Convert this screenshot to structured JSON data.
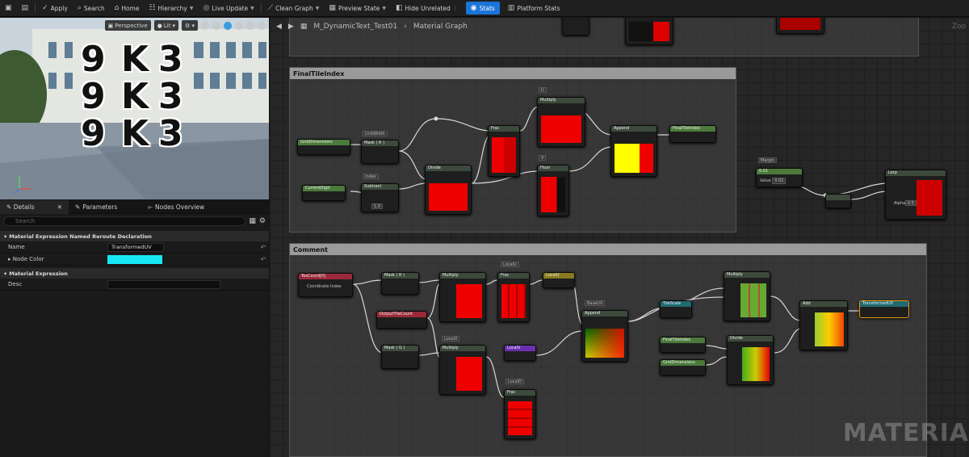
{
  "toolbar": {
    "apply": "Apply",
    "search": "Search",
    "home": "Home",
    "hierarchy": "Hierarchy",
    "live_update": "Live Update",
    "clean_graph": "Clean Graph",
    "preview_state": "Preview State",
    "hide_unrelated": "Hide Unrelated",
    "stats": "Stats",
    "platform_stats": "Platform Stats"
  },
  "viewport": {
    "perspective": "Perspective",
    "lit": "Lit",
    "digits": [
      "9",
      "K",
      "3"
    ]
  },
  "details": {
    "tabs": [
      "Details",
      "Parameters",
      "Nodes Overview"
    ],
    "search_placeholder": "Search",
    "category1": "Material Expression Named Reroute Declaration",
    "name_label": "Name",
    "name_value": "TransformedUV",
    "color_label": "Node Color",
    "color_value": "#19e6f5",
    "category2": "Material Expression",
    "desc_label": "Desc"
  },
  "graph": {
    "breadcrumb": "M_DynamicText_Test01",
    "breadcrumb2": "Material Graph",
    "zoom": "Zoo",
    "comment1": "FinalTileIndex",
    "comment2": "Comment",
    "watermark": "MATERIA",
    "nodes": {
      "grid_dimensions": "GridDimensions",
      "current_digit": "CurrentDigit",
      "mask_r": "Mask ( R )",
      "subtract": "Subtract",
      "divide": "Divide",
      "frac": "Frac",
      "multiply": "Multiply",
      "floor": "Floor",
      "append": "Append",
      "final_tile_index": "FinalTileIndex",
      "margin": "Margin",
      "margin_value": "0.01",
      "lerp": "Lerp",
      "alpha": "Alpha",
      "alpha_val": "0.5",
      "texcoord": "TexCoord[0]",
      "coord_index": "Coordinate Index",
      "output_tile_count": "OutputTileCount",
      "mask_g": "Mask ( G )",
      "local_u": "LocalU",
      "local_v": "LocalV",
      "tile_scale": "TileScale",
      "final_tile_index2": "FinalTileIndex",
      "grid_dimensions2": "GridDimensions",
      "add": "Add",
      "transformed_uv": "TransformedUV",
      "value_label": "Value",
      "sub_b": "1.0",
      "unit_width": "UnitWidth",
      "index": "Index",
      "u": "U",
      "v": "V",
      "base_uv": "BaseUV",
      "local_x": "LocalX",
      "local_u2": "LocalU",
      "local_d": "LocalD"
    }
  }
}
